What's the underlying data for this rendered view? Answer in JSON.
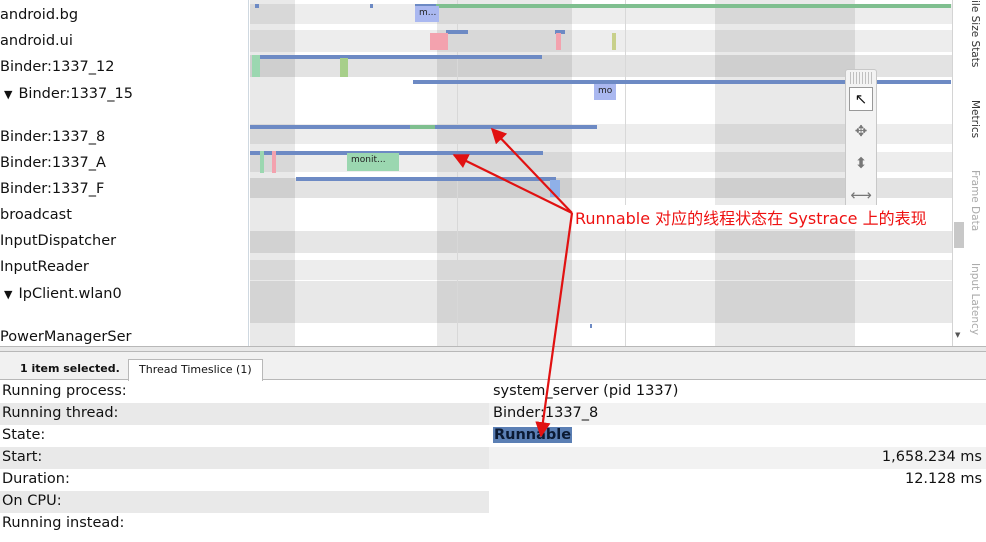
{
  "threads": [
    {
      "label": "android.bg",
      "expandable": false
    },
    {
      "label": "android.ui",
      "expandable": false
    },
    {
      "label": "Binder:1337_12",
      "expandable": false
    },
    {
      "label": "Binder:1337_15",
      "expandable": true
    },
    {
      "label": "Binder:1337_8",
      "expandable": false
    },
    {
      "label": "Binder:1337_A",
      "expandable": false
    },
    {
      "label": "Binder:1337_F",
      "expandable": false
    },
    {
      "label": "broadcast",
      "expandable": false
    },
    {
      "label": "InputDispatcher",
      "expandable": false
    },
    {
      "label": "InputReader",
      "expandable": false
    },
    {
      "label": "IpClient.wlan0",
      "expandable": true
    },
    {
      "label": "PowerManagerSer",
      "expandable": false
    }
  ],
  "expand_glyph": "▼",
  "slice_labels": {
    "android_bg": "m...",
    "binder_15": "mo",
    "binder_a": "monit..."
  },
  "mouse_modes": [
    {
      "name": "select",
      "glyph": "↖",
      "active": true
    },
    {
      "name": "pan",
      "glyph": "✥",
      "active": false
    },
    {
      "name": "zoom",
      "glyph": "⬍",
      "active": false
    },
    {
      "name": "timing",
      "glyph": "⟷",
      "active": false
    }
  ],
  "side_tabs": [
    {
      "label": "File Size Stats",
      "visible_text": "ile Size Stats",
      "dim": false
    },
    {
      "label": "Metrics",
      "visible_text": "Metrics",
      "dim": false
    },
    {
      "label": "Frame Data",
      "visible_text": "Frame Data",
      "dim": true
    },
    {
      "label": "Input Latency",
      "visible_text": "Input Latency",
      "dim": true
    }
  ],
  "analysis": {
    "selection_count": "1 item selected.",
    "tab_label": "Thread Timeslice (1)"
  },
  "details": {
    "running_process": {
      "label": "Running process:",
      "value": "system_server (pid 1337)"
    },
    "running_thread": {
      "label": "Running thread:",
      "value": "Binder:1337_8"
    },
    "state": {
      "label": "State:",
      "value": "Runnable"
    },
    "start": {
      "label": "Start:",
      "value": "1,658.234 ms"
    },
    "duration": {
      "label": "Duration:",
      "value": "12.128 ms"
    },
    "on_cpu": {
      "label": "On CPU:",
      "value": ""
    },
    "running_instead": {
      "label": "Running instead:",
      "value": ""
    }
  },
  "annotation": {
    "text": "Runnable 对应的线程状态在 Systrace 上的表现",
    "color": "#e11111"
  },
  "colors": {
    "runnable": "#6d8ac4",
    "running": "#7fbf8f",
    "sleeping_band": "#e6e6e6",
    "state_highlight": "#5b7fb4"
  }
}
